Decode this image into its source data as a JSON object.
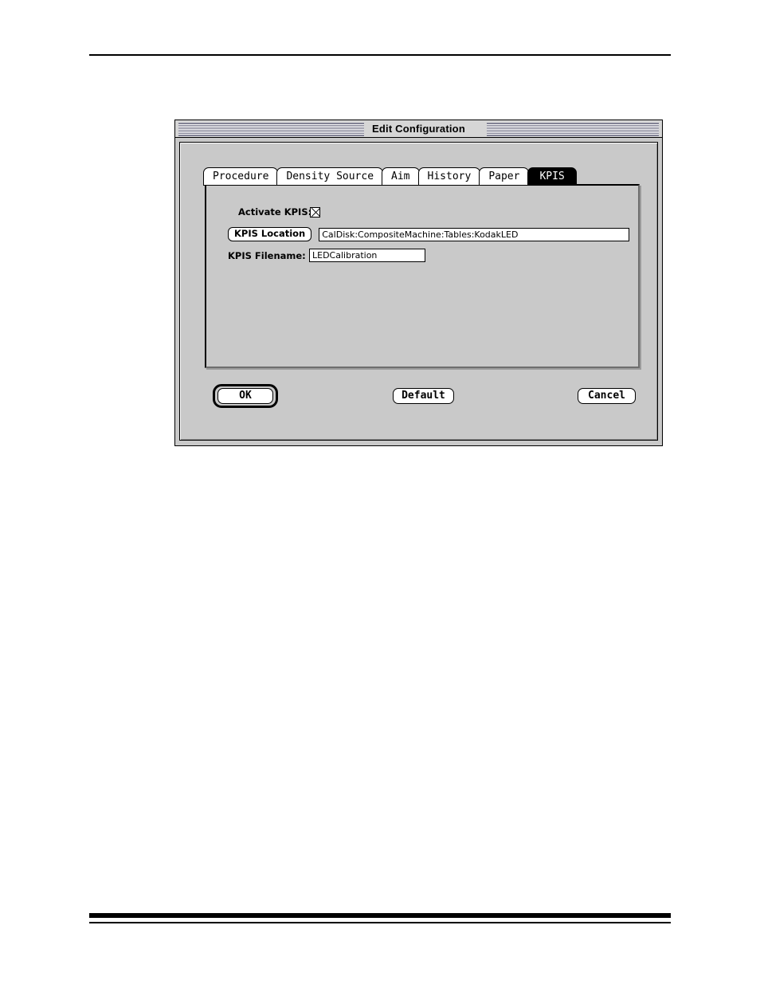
{
  "page": {
    "rules": {
      "top": true,
      "bottom_thick": true,
      "bottom_thin": true
    }
  },
  "dialog": {
    "title": "Edit Configuration",
    "tabs": [
      {
        "label": "Procedure",
        "selected": false
      },
      {
        "label": "Density Source",
        "selected": false
      },
      {
        "label": "Aim",
        "selected": false
      },
      {
        "label": "History",
        "selected": false
      },
      {
        "label": "Paper",
        "selected": false
      },
      {
        "label": "KPIS",
        "selected": true
      }
    ],
    "form": {
      "activate": {
        "label": "Activate KPIS:",
        "checked": true,
        "checkbox_glyph": "checkbox-x-icon"
      },
      "location": {
        "button_label": "KPIS Location",
        "value": "CalDisk:CompositeMachine:Tables:KodakLED",
        "placeholder": ""
      },
      "filename": {
        "label": "KPIS Filename:",
        "value": "LEDCalibration",
        "placeholder": ""
      }
    },
    "buttons": {
      "ok": "OK",
      "default": "Default",
      "cancel": "Cancel",
      "default_button": "ok"
    },
    "colors": {
      "window_face": "#c9c9c9",
      "selected_tab_bg": "#000000",
      "selected_tab_fg": "#ffffff",
      "field_bg": "#ffffff",
      "border": "#000000"
    }
  }
}
